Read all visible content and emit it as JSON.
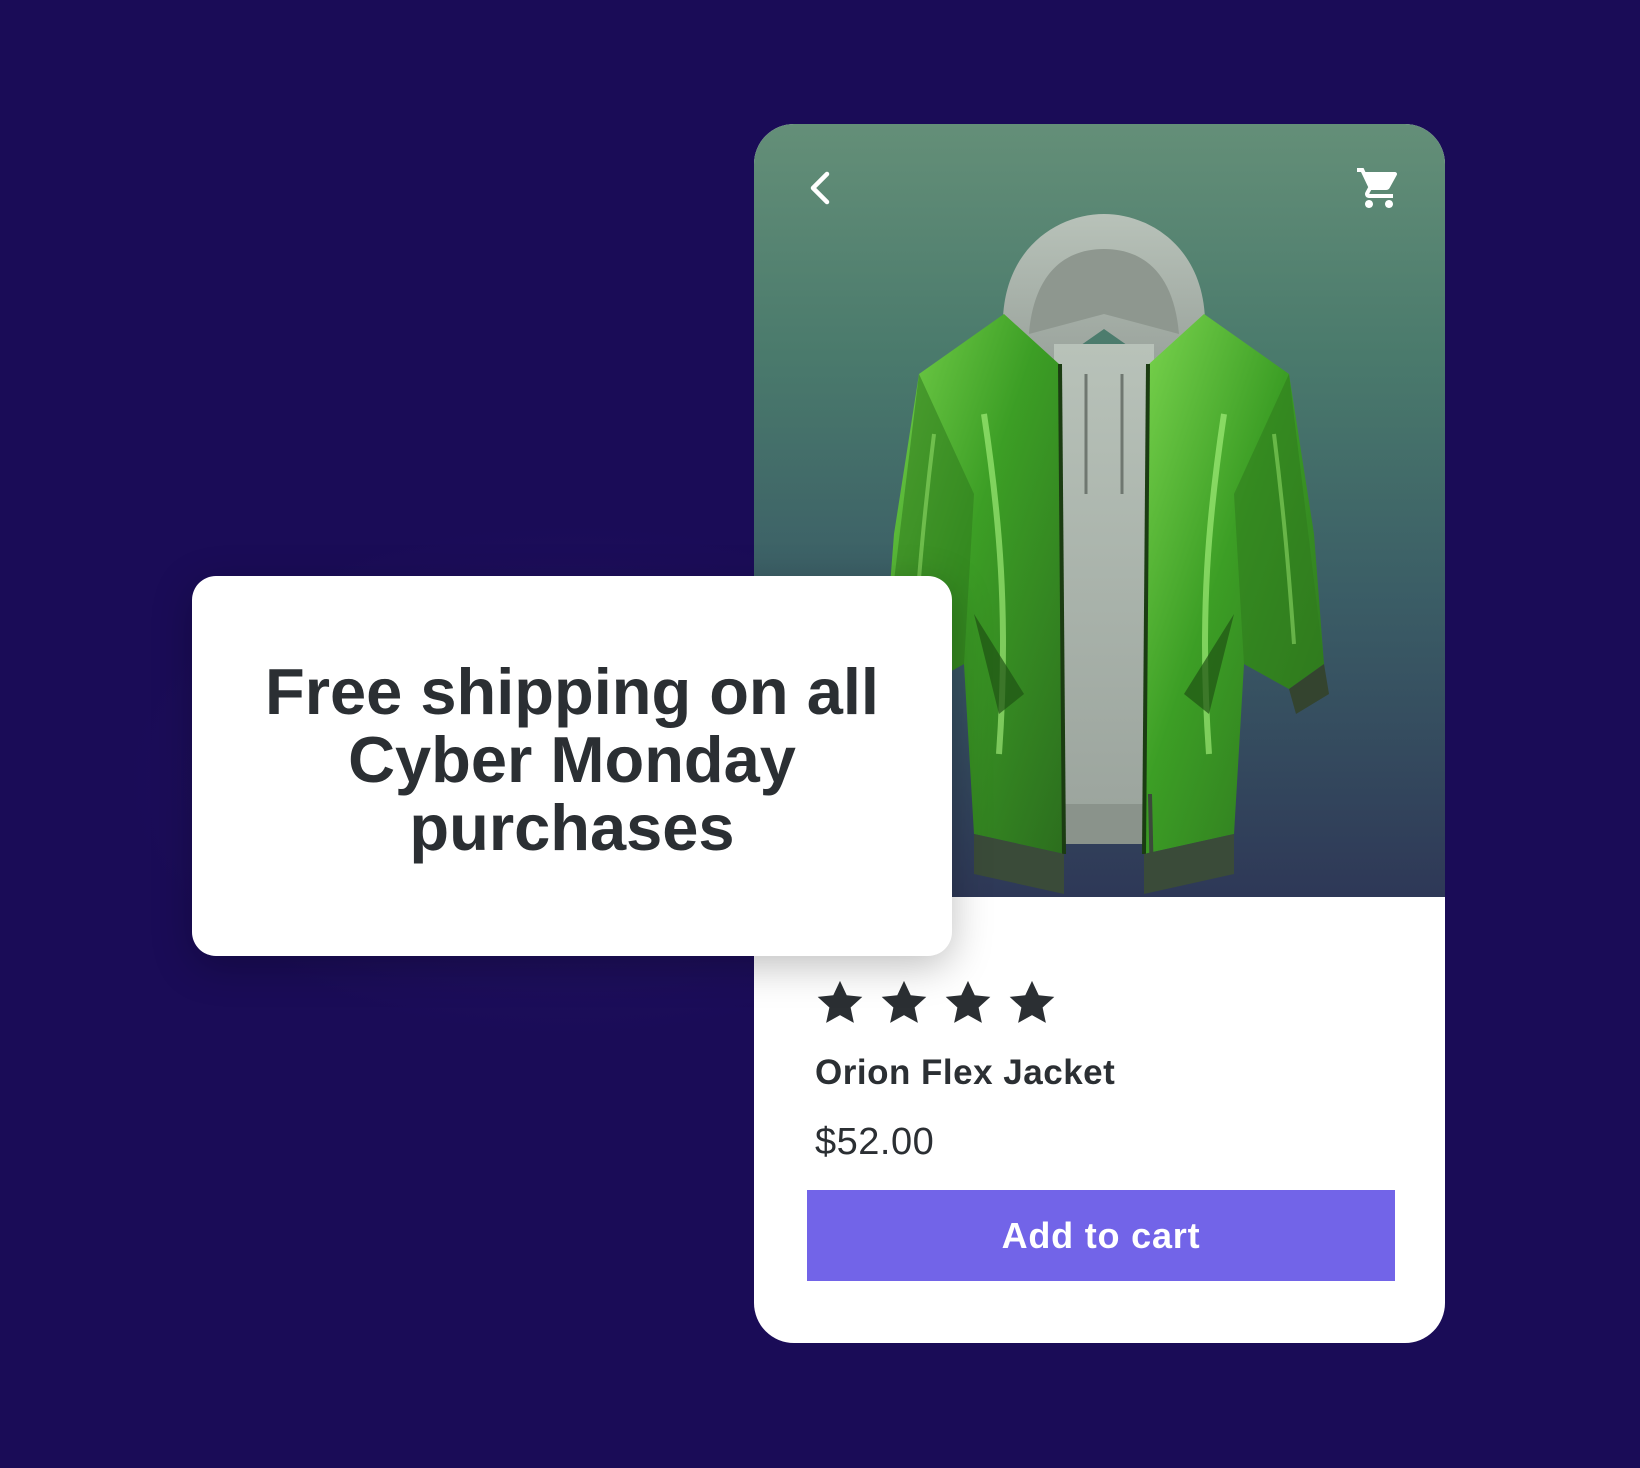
{
  "colors": {
    "background": "#1a0c57",
    "button": "#7264e8",
    "text": "#2b2f33",
    "jacket_green": "#3fb12a"
  },
  "product_card": {
    "header": {
      "back_icon": "chevron-left-icon",
      "cart_icon": "shopping-cart-icon"
    },
    "image": "green-jacket-with-gray-hoodie",
    "rating": {
      "stars": 4
    },
    "name": "Orion Flex Jacket",
    "price": "$52.00",
    "add_to_cart_label": "Add to cart"
  },
  "promo": {
    "text": "Free shipping on all Cyber Monday purchases"
  }
}
